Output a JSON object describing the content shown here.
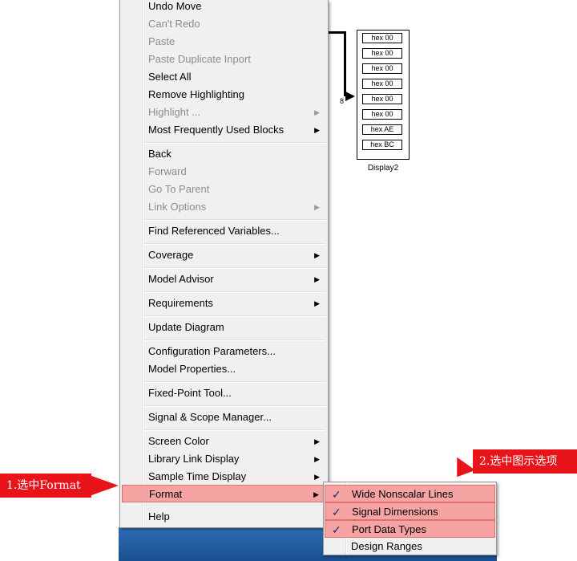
{
  "menu": {
    "items": [
      {
        "label": "Undo Move",
        "enabled": true,
        "submenu": false
      },
      {
        "label": "Can't Redo",
        "enabled": false,
        "submenu": false
      },
      {
        "label": "Paste",
        "enabled": false,
        "submenu": false
      },
      {
        "label": "Paste Duplicate Inport",
        "enabled": false,
        "submenu": false
      },
      {
        "label": "Select All",
        "enabled": true,
        "submenu": false
      },
      {
        "label": "Remove Highlighting",
        "enabled": true,
        "submenu": false
      },
      {
        "label": "Highlight ...",
        "enabled": false,
        "submenu": true
      },
      {
        "label": "Most Frequently Used Blocks",
        "enabled": true,
        "submenu": true
      },
      {
        "label": "Back",
        "enabled": true,
        "submenu": false
      },
      {
        "label": "Forward",
        "enabled": false,
        "submenu": false
      },
      {
        "label": "Go To Parent",
        "enabled": false,
        "submenu": false
      },
      {
        "label": "Link Options",
        "enabled": false,
        "submenu": true
      },
      {
        "label": "Find Referenced Variables...",
        "enabled": true,
        "submenu": false
      },
      {
        "label": "Coverage",
        "enabled": true,
        "submenu": true
      },
      {
        "label": "Model Advisor",
        "enabled": true,
        "submenu": true
      },
      {
        "label": "Requirements",
        "enabled": true,
        "submenu": true
      },
      {
        "label": "Update Diagram",
        "enabled": true,
        "submenu": false
      },
      {
        "label": "Configuration Parameters...",
        "enabled": true,
        "submenu": false
      },
      {
        "label": "Model Properties...",
        "enabled": true,
        "submenu": false
      },
      {
        "label": "Fixed-Point Tool...",
        "enabled": true,
        "submenu": false
      },
      {
        "label": "Signal & Scope Manager...",
        "enabled": true,
        "submenu": false
      },
      {
        "label": "Screen Color",
        "enabled": true,
        "submenu": true
      },
      {
        "label": "Library Link Display",
        "enabled": true,
        "submenu": true
      },
      {
        "label": "Sample Time Display",
        "enabled": true,
        "submenu": true
      },
      {
        "label": "Format",
        "enabled": true,
        "submenu": true,
        "highlighted": true
      },
      {
        "label": "Help",
        "enabled": true,
        "submenu": false
      }
    ]
  },
  "format_submenu": {
    "items": [
      {
        "label": "Wide Nonscalar Lines",
        "checked": true,
        "highlighted": true
      },
      {
        "label": "Signal Dimensions",
        "checked": true,
        "highlighted": true
      },
      {
        "label": "Port Data Types",
        "checked": true,
        "highlighted": true
      },
      {
        "label": "Design Ranges",
        "checked": false,
        "highlighted": false
      }
    ],
    "check_glyph": "✓"
  },
  "display_block": {
    "values": [
      "hex 00",
      "hex 00",
      "hex 00",
      "hex 00",
      "hex 00",
      "hex 00",
      "hex AE",
      "hex BC"
    ],
    "name": "Display2",
    "signal_dimension": "8"
  },
  "callouts": {
    "step1": "1.选中Format",
    "step2": "2.选中图示选项"
  },
  "colors": {
    "highlight": "#f5a3a3",
    "callout": "#e8141a",
    "taskbar": "#2c6cb5"
  }
}
